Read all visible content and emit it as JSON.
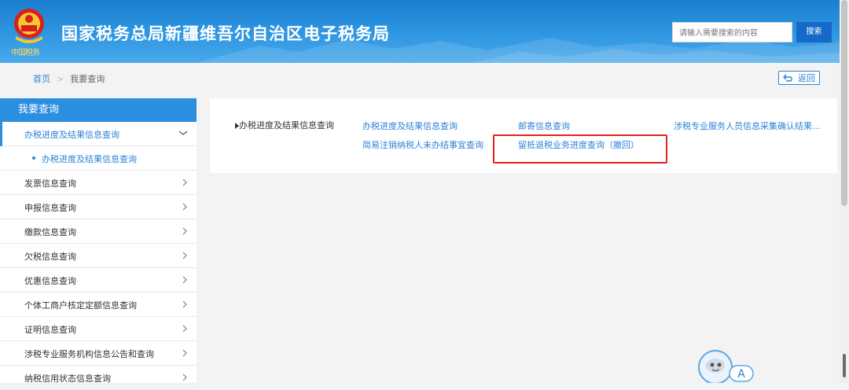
{
  "header": {
    "site_title": "国家税务总局新疆维吾尔自治区电子税务局",
    "slogan": "中国税务",
    "search_placeholder": "请输入需要搜索的内容",
    "search_button": "搜索",
    "colors": {
      "header_blue": "#2f97e2",
      "search_button": "#1469c9"
    }
  },
  "breadcrumb": {
    "home": "首页",
    "separator": ">",
    "current": "我要查询"
  },
  "back_button": {
    "label": "返回",
    "icon": "return-arrow-icon"
  },
  "sidebar": {
    "title": "我要查询",
    "active_item": {
      "label": "办税进度及结果信息查询",
      "icon": "chevron-down-icon"
    },
    "active_sub": {
      "label": "办税进度及结果信息查询"
    },
    "items": [
      {
        "label": "发票信息查询"
      },
      {
        "label": "申报信息查询"
      },
      {
        "label": "缴款信息查询"
      },
      {
        "label": "欠税信息查询"
      },
      {
        "label": "优惠信息查询"
      },
      {
        "label": "个体工商户核定定额信息查询"
      },
      {
        "label": "证明信息查询"
      },
      {
        "label": "涉税专业服务机构信息公告和查询"
      },
      {
        "label": "纳税信用状态信息查询"
      }
    ],
    "accent_color": "#2b8fe0"
  },
  "content": {
    "category": "办税进度及结果信息查询",
    "links": [
      {
        "label": "办税进度及结果信息查询"
      },
      {
        "label": "邮寄信息查询"
      },
      {
        "label": "涉税专业服务人员信息采集确认结果..."
      },
      {
        "label": "简易注销纳税人未办结事宜查询"
      },
      {
        "label": "留抵退税业务进度查询（撤回）"
      }
    ],
    "highlight_color": "#e3211f"
  },
  "assistant": {
    "label": "A",
    "icon": "robot-assistant-icon"
  }
}
